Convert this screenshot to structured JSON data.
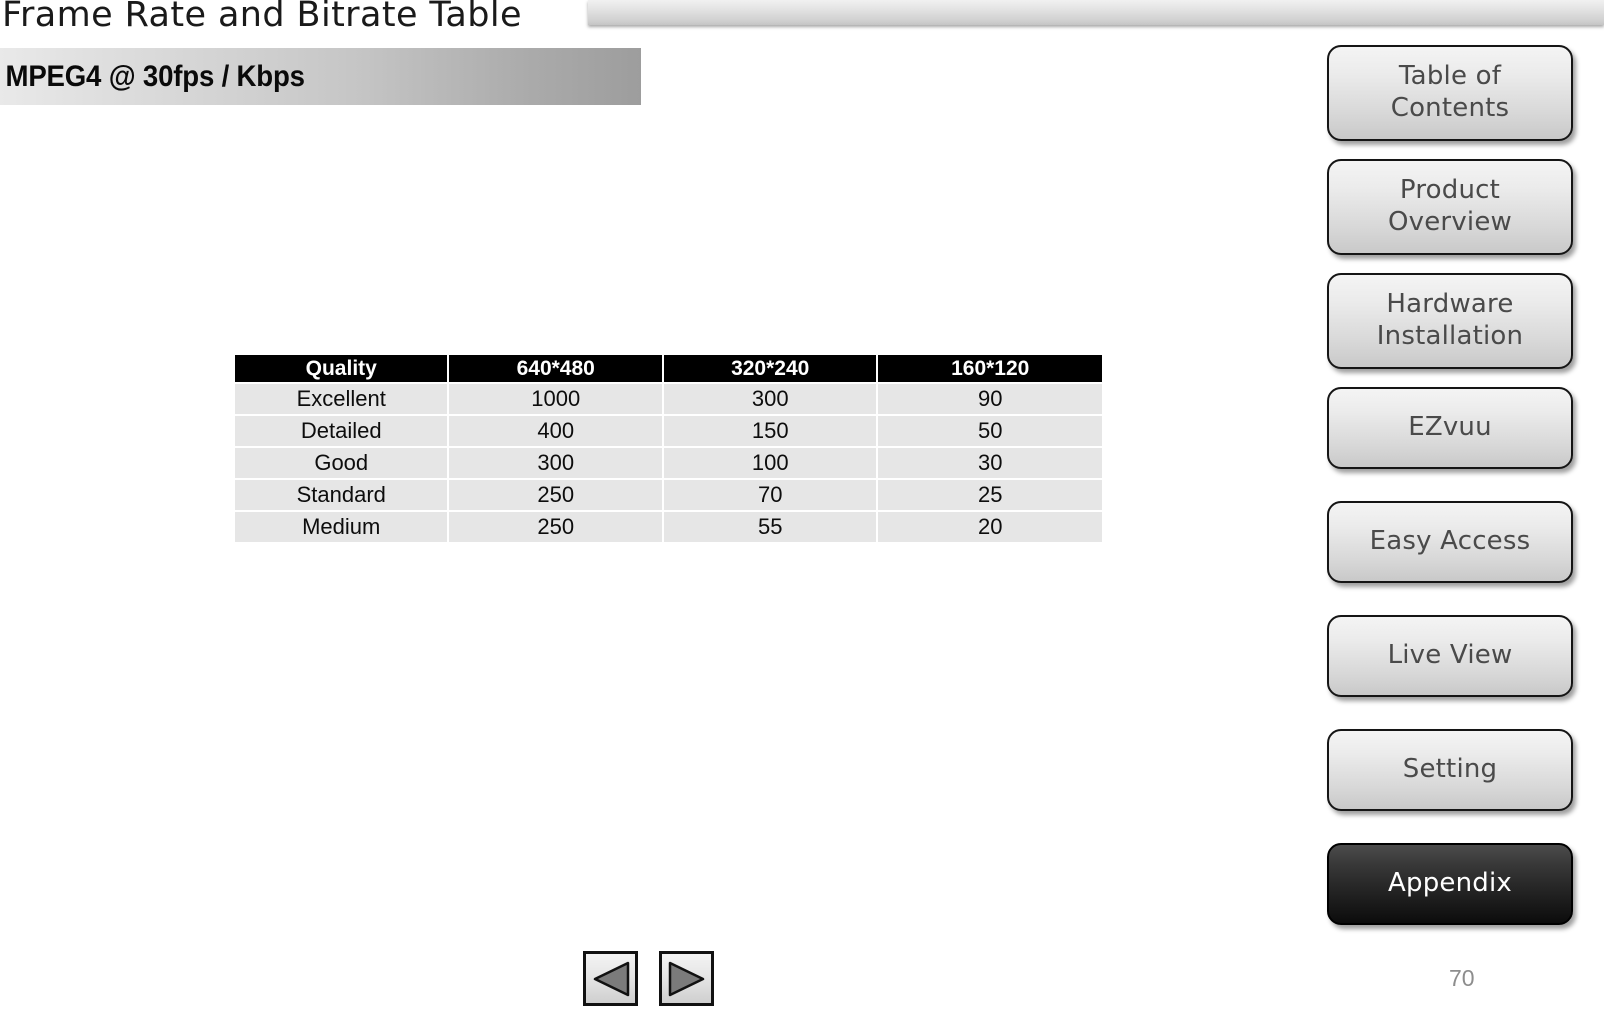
{
  "header": {
    "title": "Frame Rate and Bitrate Table",
    "subtitle": "MPEG4 @ 30fps / Kbps"
  },
  "table": {
    "columns": [
      "Quality",
      "640*480",
      "320*240",
      "160*120"
    ],
    "rows": [
      [
        "Excellent",
        "1000",
        "300",
        "90"
      ],
      [
        "Detailed",
        "400",
        "150",
        "50"
      ],
      [
        "Good",
        "300",
        "100",
        "30"
      ],
      [
        "Standard",
        "250",
        "70",
        "25"
      ],
      [
        "Medium",
        "250",
        "55",
        "20"
      ]
    ]
  },
  "sidebar": {
    "items": [
      {
        "label": "Table of Contents",
        "line1": "Table of",
        "line2": "Contents",
        "active": false
      },
      {
        "label": "Product Overview",
        "line1": "Product",
        "line2": "Overview",
        "active": false
      },
      {
        "label": "Hardware Installation",
        "line1": "Hardware",
        "line2": "Installation",
        "active": false
      },
      {
        "label": "EZvuu",
        "line1": "EZvuu",
        "line2": "",
        "active": false
      },
      {
        "label": "Easy Access",
        "line1": "Easy Access",
        "line2": "",
        "active": false
      },
      {
        "label": "Live View",
        "line1": "Live View",
        "line2": "",
        "active": false
      },
      {
        "label": "Setting",
        "line1": "Setting",
        "line2": "",
        "active": false
      },
      {
        "label": "Appendix",
        "line1": "Appendix",
        "line2": "",
        "active": true
      }
    ]
  },
  "navigation": {
    "previous_icon": "triangle-left-icon",
    "next_icon": "triangle-right-icon",
    "previous_label": "Previous slide",
    "next_label": "Next slide"
  },
  "footer": {
    "page_number": "70"
  },
  "colors": {
    "header_band_start": "#e9e9e9",
    "header_band_end": "#9d9d9d",
    "table_header_bg": "#000000",
    "table_row_bg": "#e6e6e6",
    "active_button_bg": "#1d1d1d",
    "page_number_color": "#8d8d8d"
  }
}
